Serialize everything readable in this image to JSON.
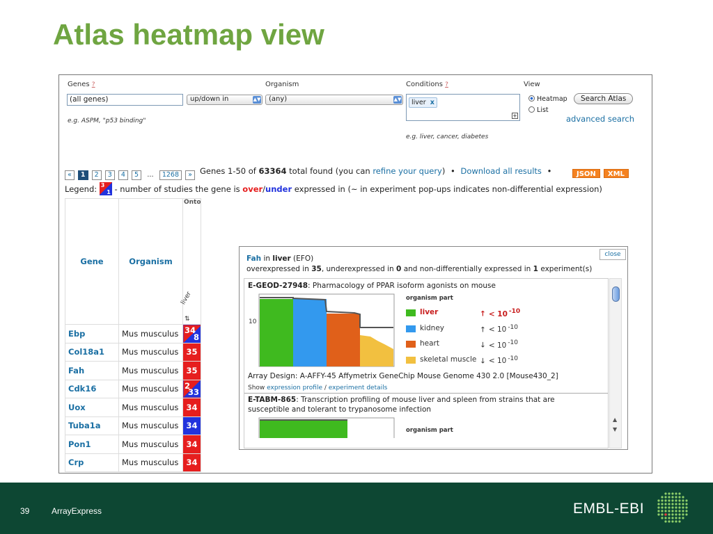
{
  "slide": {
    "title": "Atlas heatmap view",
    "page_number": "39",
    "footer_label": "ArrayExpress",
    "logo_text": "EMBL-EBI"
  },
  "colors": {
    "title_green": "#6fa541",
    "footer_bg": "#0d4733",
    "over_red": "#e61e1e",
    "under_blue": "#2233dd"
  },
  "form": {
    "genes_label": "Genes",
    "genes_help": "?",
    "genes_value": "(all genes)",
    "updown_value": "up/down in",
    "genes_example": "e.g. ASPM, \"p53 binding\"",
    "organism_label": "Organism",
    "organism_value": "(any)",
    "conditions_label": "Conditions",
    "conditions_help": "?",
    "condition_tag": "liver",
    "condition_tag_remove": "x",
    "conditions_expand": "+",
    "conditions_example": "e.g. liver, cancer, diabetes",
    "view_label": "View",
    "view_heatmap": "Heatmap",
    "view_list": "List",
    "search_button": "Search Atlas",
    "advanced_search": "advanced search"
  },
  "pager": {
    "prev": "«",
    "pages": [
      "1",
      "2",
      "3",
      "4",
      "5"
    ],
    "ellipsis": "...",
    "last": "1268",
    "next": "»",
    "genes_range": "Genes 1-50 of ",
    "total": "63364",
    "total_suffix": " total found (you can ",
    "refine": "refine your query",
    "close_paren": ")",
    "bullet": "•",
    "download": "Download all results",
    "json": "JSON",
    "xml": "XML"
  },
  "legend": {
    "label": "Legend:",
    "over_num": "3",
    "under_num": "1",
    "text1": " - number of studies the gene is ",
    "over": "over",
    "slash": "/",
    "under": "under",
    "text2": " expressed in (~ in experiment pop-ups indicates non-differential expression)"
  },
  "table": {
    "header_gene": "Gene",
    "header_organism": "Organism",
    "header_onto": "Onto",
    "header_condition": "liver",
    "sort_icon": "⇅",
    "rows": [
      {
        "gene": "Ebp",
        "organism": "Mus musculus",
        "over": "34",
        "under": "8",
        "kind": "split"
      },
      {
        "gene": "Col18a1",
        "organism": "Mus musculus",
        "value": "35",
        "kind": "red"
      },
      {
        "gene": "Fah",
        "organism": "Mus musculus",
        "value": "35",
        "kind": "red"
      },
      {
        "gene": "Cdk16",
        "organism": "Mus musculus",
        "over": "2",
        "under": "33",
        "kind": "split"
      },
      {
        "gene": "Uox",
        "organism": "Mus musculus",
        "value": "34",
        "kind": "red"
      },
      {
        "gene": "Tuba1a",
        "organism": "Mus musculus",
        "value": "34",
        "kind": "blue"
      },
      {
        "gene": "Pon1",
        "organism": "Mus musculus",
        "value": "34",
        "kind": "red"
      },
      {
        "gene": "Crp",
        "organism": "Mus musculus",
        "value": "34",
        "kind": "red"
      }
    ]
  },
  "popup": {
    "close": "close",
    "gene": "Fah",
    "in": " in ",
    "condition": "liver",
    "ontology": " (EFO)",
    "summary": {
      "a": "overexpressed in ",
      "over": "35",
      "b": ", underexpressed in ",
      "under": "0",
      "c": " and non-differentially expressed in ",
      "nd": "1",
      "d": " experiment(s)"
    },
    "exp1": {
      "id": "E-GEOD-27948",
      "desc": ": Pharmacology of PPAR isoform agonists on mouse"
    },
    "chart_axis_label": "10",
    "legend_title": "organism part",
    "legend_items": [
      {
        "name": "liver",
        "arrow": "↑",
        "pval": "< 10",
        "exp": "-10",
        "color": "#3fba1f"
      },
      {
        "name": "kidney",
        "arrow": "↑",
        "pval": "< 10",
        "exp": "-10",
        "color": "#3399ee"
      },
      {
        "name": "heart",
        "arrow": "↓",
        "pval": "< 10",
        "exp": "-10",
        "color": "#e0601a"
      },
      {
        "name": "skeletal muscle",
        "arrow": "↓",
        "pval": "< 10",
        "exp": "-10",
        "color": "#f2c040"
      }
    ],
    "array_design": "Array Design: A-AFFY-45 Affymetrix GeneChip Mouse Genome 430 2.0 [Mouse430_2]",
    "show": "Show ",
    "expression_profile": "expression profile",
    "sep": " / ",
    "experiment_details": "experiment details",
    "exp2": {
      "id": "E-TABM-865",
      "desc_line1": ": Transcription profiling of mouse liver and spleen from strains that are",
      "desc_line2": "susceptible and tolerant to trypanosome infection"
    },
    "exp2_legend_title": "organism part",
    "scroll_up": "▲",
    "scroll_down": "▼"
  }
}
